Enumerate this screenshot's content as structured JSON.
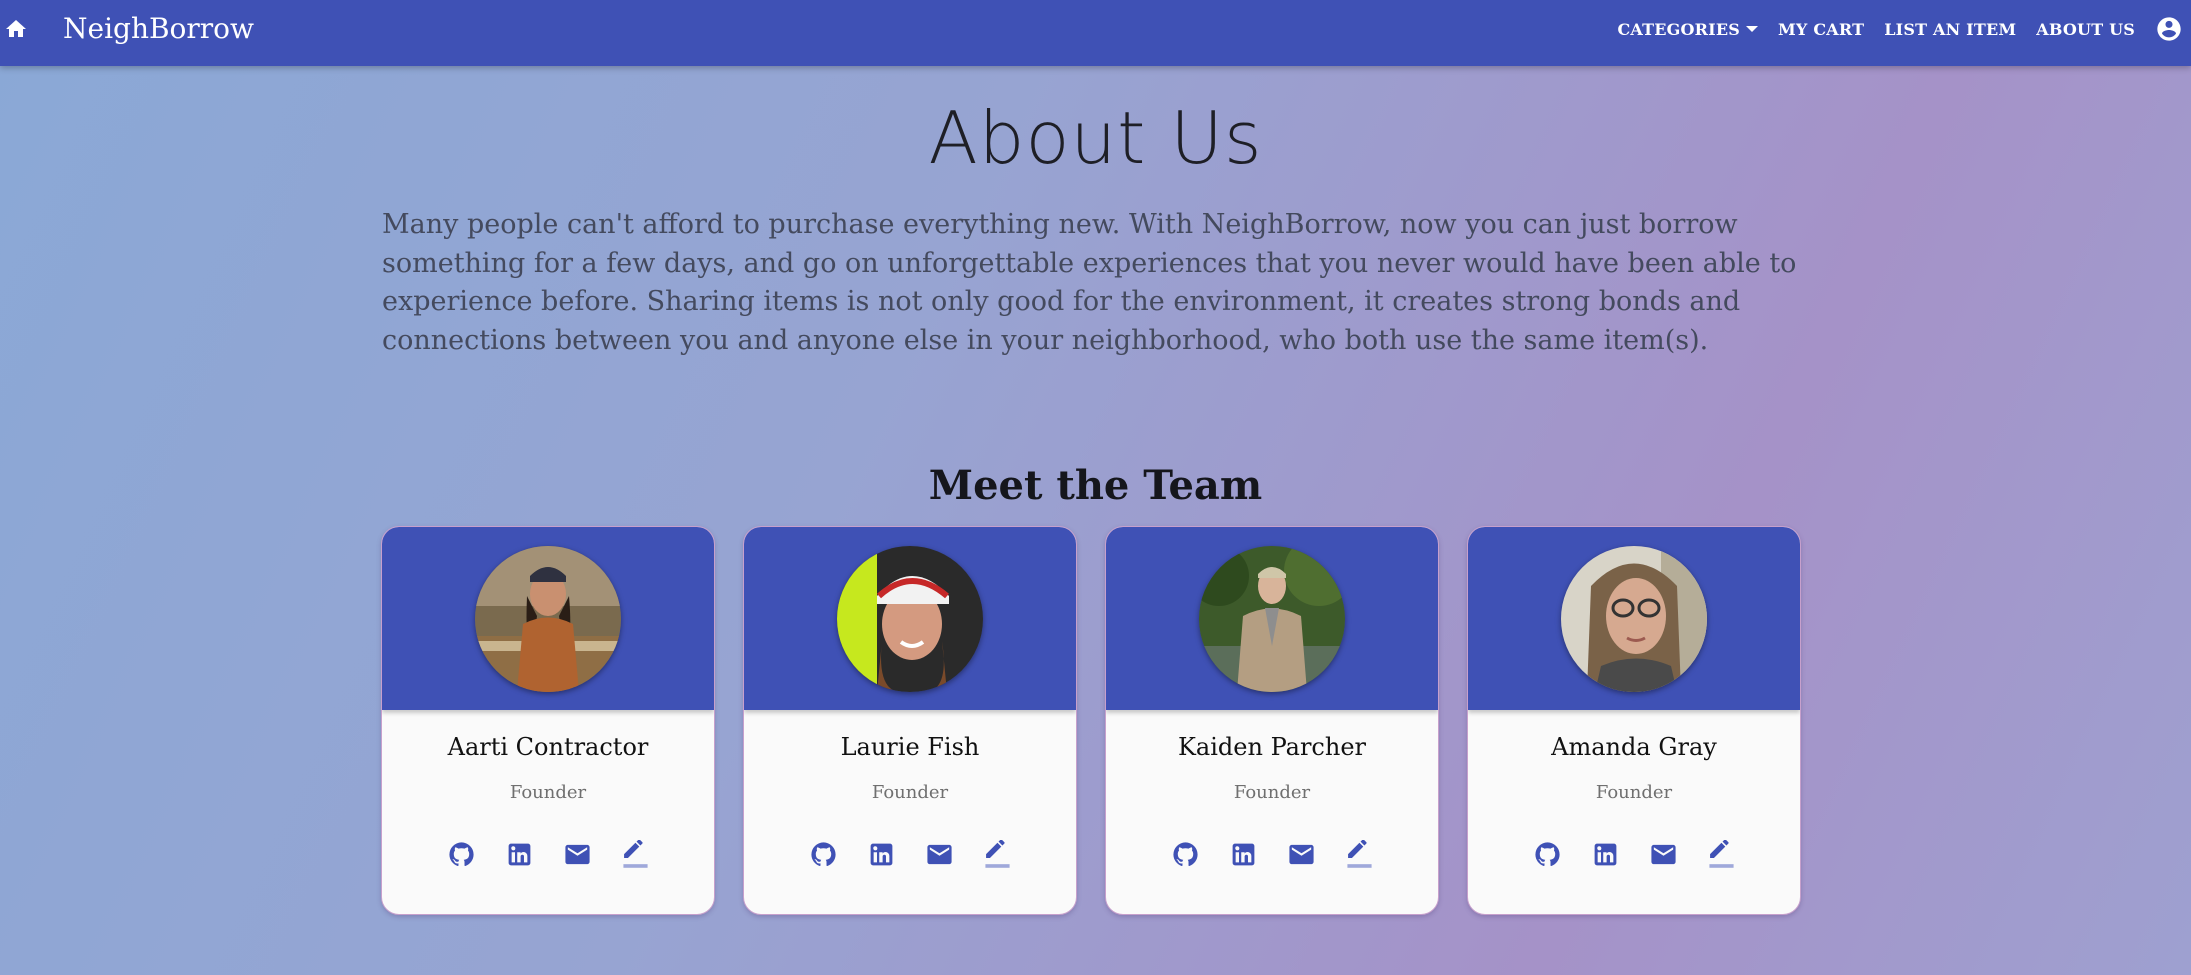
{
  "navbar": {
    "brand": "NeighBorrow",
    "links": {
      "categories": "CATEGORIES",
      "my_cart": "MY CART",
      "list_item": "LIST AN ITEM",
      "about_us": "ABOUT US"
    },
    "icons": {
      "home": "home-icon",
      "account": "account-circle-icon",
      "dropdown": "caret-down-icon"
    }
  },
  "main": {
    "title": "About Us",
    "intro": "Many people can't afford to purchase everything new. With NeighBorrow, now you can just borrow something for a few days, and go on unforgettable experiences that you never would have been able to experience before. Sharing items is not only good for the environment, it creates strong bonds and connections between you and anyone else in your neighborhood, who both use the same item(s).",
    "team_heading": "Meet the Team",
    "team": [
      {
        "name": "Aarti Contractor",
        "role": "Founder"
      },
      {
        "name": "Laurie Fish",
        "role": "Founder"
      },
      {
        "name": "Kaiden Parcher",
        "role": "Founder"
      },
      {
        "name": "Amanda Gray",
        "role": "Founder"
      }
    ],
    "card_icons": [
      "github-icon",
      "linkedin-icon",
      "email-icon",
      "edit-pencil-icon"
    ]
  },
  "colors": {
    "primary": "#3f51b5",
    "background_start": "#8aa8d6",
    "background_end": "#a592c8",
    "card": "#fafafa"
  }
}
